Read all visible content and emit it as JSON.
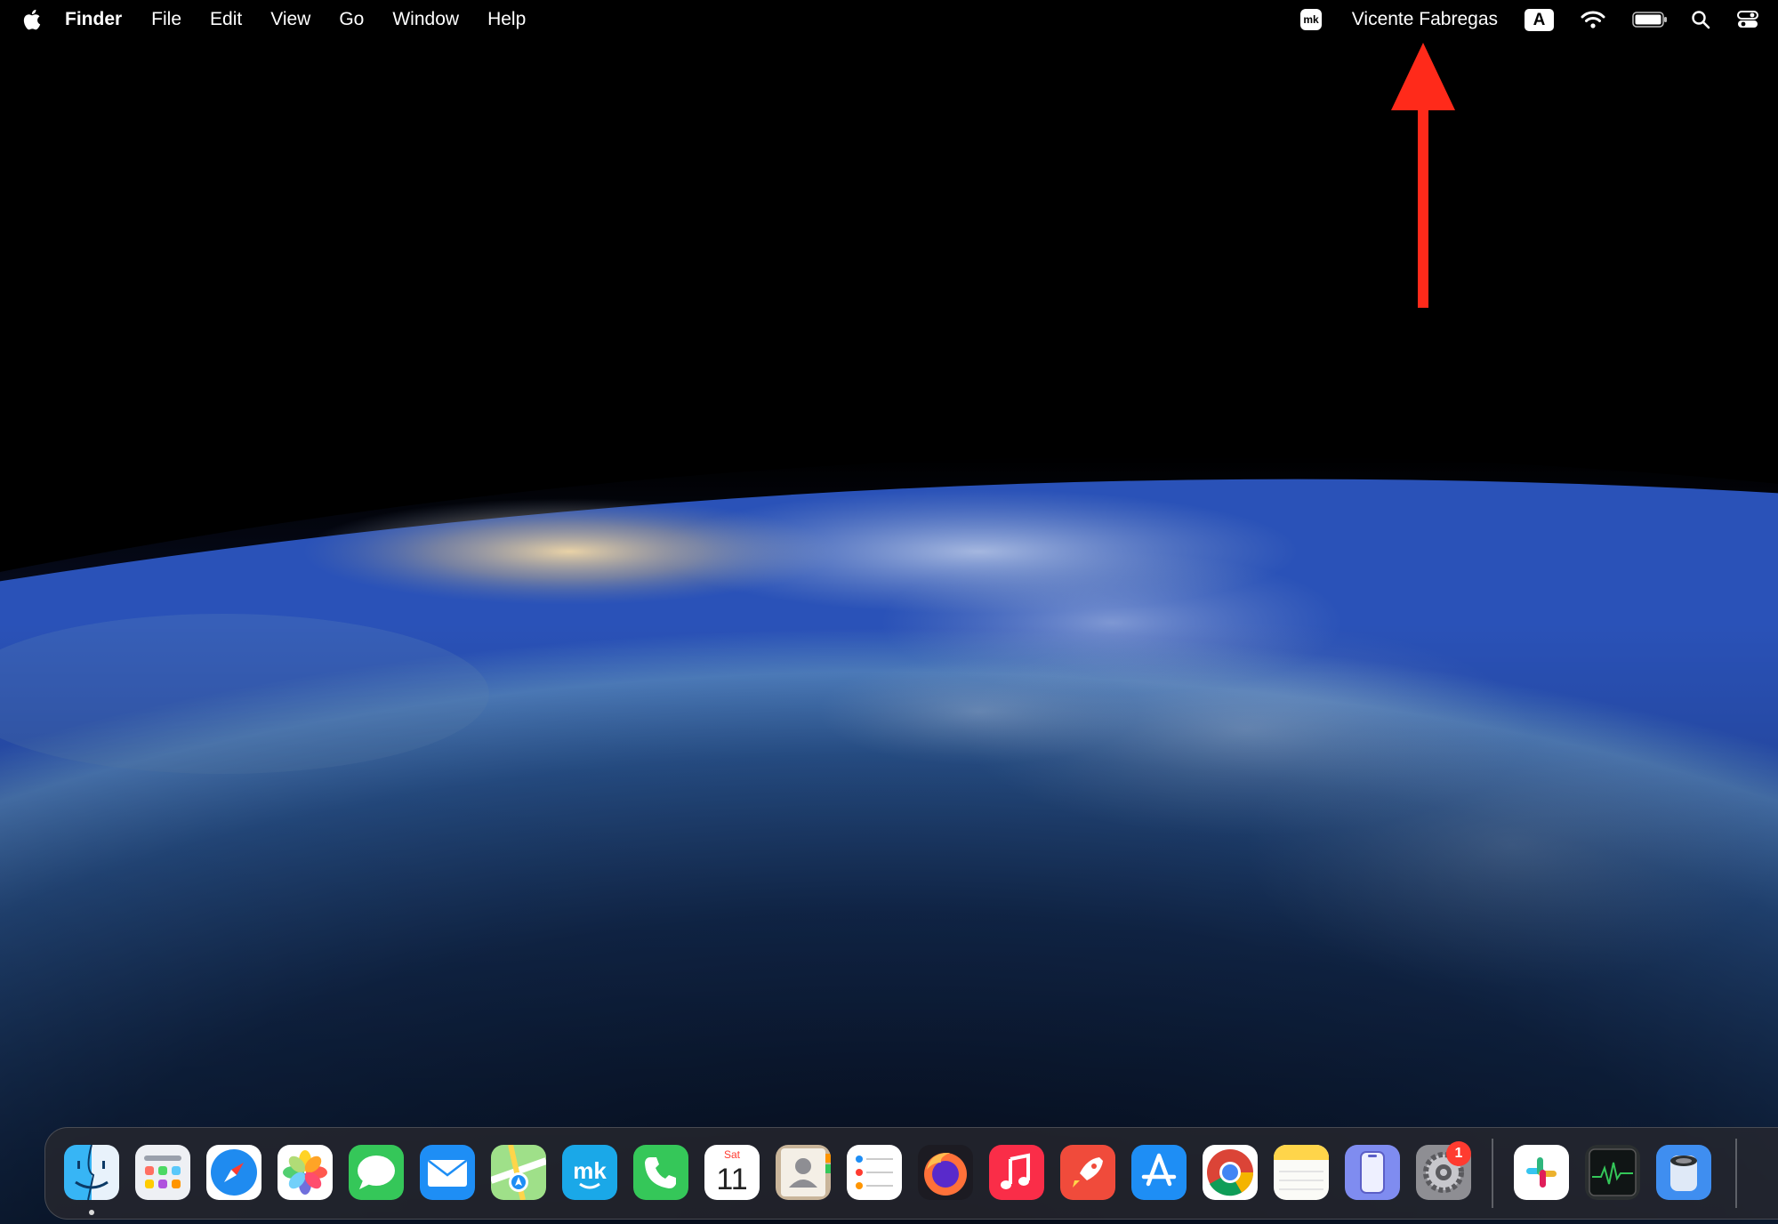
{
  "menubar": {
    "apple_icon": "apple-logo-icon",
    "app_name": "Finder",
    "menus": [
      "File",
      "Edit",
      "View",
      "Go",
      "Window",
      "Help"
    ],
    "status": {
      "user_name": "Vicente Fabregas",
      "input_source": "A",
      "icons": [
        "mk-app-icon",
        "wifi-icon",
        "battery-icon",
        "spotlight-search-icon",
        "control-center-icon"
      ]
    }
  },
  "annotation": {
    "arrow_color": "#ff2a1a"
  },
  "dock": {
    "apps": [
      {
        "name": "Finder",
        "icon": "finder-icon",
        "running": true
      },
      {
        "name": "Launchpad",
        "icon": "launchpad-icon"
      },
      {
        "name": "Safari",
        "icon": "safari-icon"
      },
      {
        "name": "Photos",
        "icon": "photos-icon"
      },
      {
        "name": "Messages",
        "icon": "messages-icon"
      },
      {
        "name": "Mail",
        "icon": "mail-icon"
      },
      {
        "name": "Maps",
        "icon": "maps-icon"
      },
      {
        "name": "mk",
        "icon": "mk-icon"
      },
      {
        "name": "Phone",
        "icon": "phone-icon"
      },
      {
        "name": "Calendar",
        "icon": "calendar-icon",
        "weekday": "Sat",
        "day": "11"
      },
      {
        "name": "Contacts",
        "icon": "contacts-icon"
      },
      {
        "name": "Reminders",
        "icon": "reminders-icon"
      },
      {
        "name": "Firefox",
        "icon": "firefox-icon"
      },
      {
        "name": "Music",
        "icon": "music-icon"
      },
      {
        "name": "RocketSim",
        "icon": "rocket-icon"
      },
      {
        "name": "App Store",
        "icon": "app-store-icon"
      },
      {
        "name": "Chrome",
        "icon": "chrome-icon"
      },
      {
        "name": "Notes",
        "icon": "notes-icon"
      },
      {
        "name": "iPhone Mirroring",
        "icon": "iphone-mirroring-icon"
      },
      {
        "name": "System Settings",
        "icon": "system-settings-icon",
        "badge": "1"
      },
      {
        "name": "Slack",
        "icon": "slack-icon"
      },
      {
        "name": "Activity Monitor",
        "icon": "activity-monitor-icon"
      },
      {
        "name": "Storage",
        "icon": "storage-icon"
      }
    ]
  }
}
